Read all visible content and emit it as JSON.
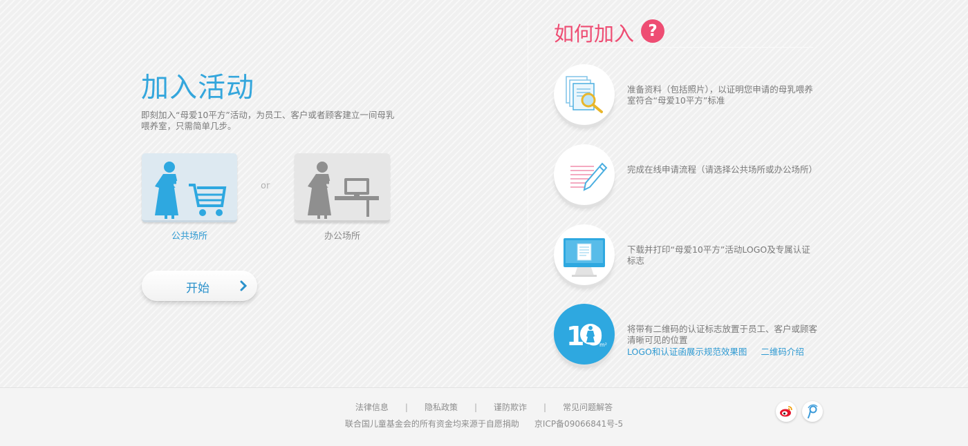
{
  "join": {
    "title": "加入活动",
    "description": "即刻加入“母爱10平方”活动，为员工、客户或者顾客建立一间母乳喂养室，只需简单几步。",
    "venues": [
      {
        "label": "公共场所",
        "icon": "mother-cart-icon"
      },
      {
        "label": "办公场所",
        "icon": "mother-desk-icon"
      }
    ],
    "or_text": "or",
    "start_label": "开始"
  },
  "how": {
    "title": "如何加入",
    "question_mark": "?",
    "steps": [
      {
        "icon": "documents-search-icon",
        "text": "准备资料（包括照片），以证明您申请的母乳喂养室符合“母爱10平方”标准"
      },
      {
        "icon": "form-pencil-icon",
        "text": "完成在线申请流程（请选择公共场所或办公场所）"
      },
      {
        "icon": "monitor-print-icon",
        "text": "下载并打印“母爱10平方”活动LOGO及专属认证标志"
      },
      {
        "icon": "ten-square-logo-icon",
        "text": "将带有二维码的认证标志放置于员工、客户或顾客清晰可见的位置",
        "logo_number": "10",
        "logo_unit": "m²"
      }
    ],
    "links": [
      "LOGO和认证函展示规范效果图",
      "二维码介绍"
    ]
  },
  "footer": {
    "links": [
      "法律信息",
      "隐私政策",
      "谨防欺诈",
      "常见问题解答"
    ],
    "separator": "|",
    "copyright": "联合国儿童基金会的所有资金均来源于自愿捐助",
    "icp": "京ICP备09066841号-5",
    "social": [
      "weibo-icon",
      "tencent-weibo-icon"
    ]
  },
  "colors": {
    "accent_blue": "#34a6dc",
    "accent_pink": "#ee4d73",
    "text_gray": "#7a7a7a"
  }
}
